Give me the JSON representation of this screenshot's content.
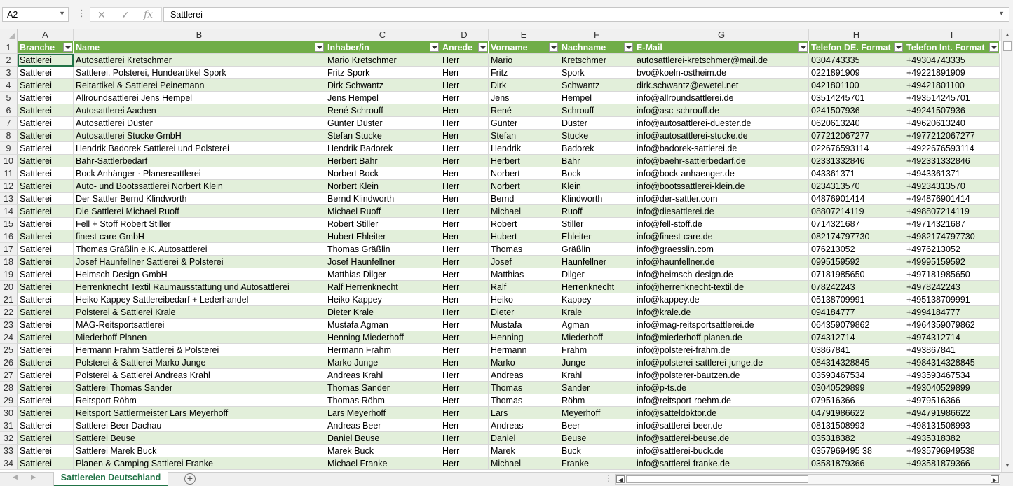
{
  "formula_bar": {
    "name_box": "A2",
    "formula": "Sattlerei",
    "cancel_glyph": "✕",
    "enter_glyph": "✓",
    "fx_glyph": "fx"
  },
  "columns": [
    "A",
    "B",
    "C",
    "D",
    "E",
    "F",
    "G",
    "H",
    "I"
  ],
  "header_row": [
    "Branche",
    "Name",
    "Inhaber/in",
    "Anrede",
    "Vorname",
    "Nachname",
    "E-Mail",
    "Telefon DE. Format",
    "Telefon Int. Format"
  ],
  "rows": [
    [
      "Sattlerei",
      "Autosattlerei Kretschmer",
      "Mario Kretschmer",
      "Herr",
      "Mario",
      "Kretschmer",
      "autosattlerei-kretschmer@mail.de",
      "0304743335",
      "+49304743335"
    ],
    [
      "Sattlerei",
      "Sattlerei, Polsterei, Hundeartikel Spork",
      "Fritz Spork",
      "Herr",
      "Fritz",
      "Spork",
      "bvo@koeln-ostheim.de",
      "0221891909",
      "+49221891909"
    ],
    [
      "Sattlerei",
      "Reitartikel & Sattlerei Peinemann",
      "Dirk Schwantz",
      "Herr",
      "Dirk",
      "Schwantz",
      "dirk.schwantz@ewetel.net",
      "0421801100",
      "+49421801100"
    ],
    [
      "Sattlerei",
      "Allroundsattlerei Jens Hempel",
      "Jens Hempel",
      "Herr",
      "Jens",
      "Hempel",
      "info@allroundsattlerei.de",
      "03514245701",
      "+493514245701"
    ],
    [
      "Sattlerei",
      "Autosattlerei Aachen",
      "René Schrouff",
      "Herr",
      "René",
      "Schrouff",
      "info@asc-schrouff.de",
      "0241507936",
      "+49241507936"
    ],
    [
      "Sattlerei",
      "Autosattlerei Düster",
      "Günter Düster",
      "Herr",
      "Günter",
      "Düster",
      "info@autosattlerei-duester.de",
      "0620613240",
      "+49620613240"
    ],
    [
      "Sattlerei",
      "Autosattlerei Stucke GmbH",
      "Stefan Stucke",
      "Herr",
      "Stefan",
      "Stucke",
      "info@autosattlerei-stucke.de",
      "077212067277",
      "+4977212067277"
    ],
    [
      "Sattlerei",
      "Hendrik Badorek Sattlerei und Polsterei",
      "Hendrik Badorek",
      "Herr",
      "Hendrik",
      "Badorek",
      "info@badorek-sattlerei.de",
      "022676593114",
      "+4922676593114"
    ],
    [
      "Sattlerei",
      "Bähr-Sattlerbedarf",
      "Herbert Bähr",
      "Herr",
      "Herbert",
      "Bähr",
      "info@baehr-sattlerbedarf.de",
      "02331332846",
      "+492331332846"
    ],
    [
      "Sattlerei",
      "Bock Anhänger · Planensattlerei",
      "Norbert Bock",
      "Herr",
      "Norbert",
      "Bock",
      "info@bock-anhaenger.de",
      "043361371",
      "+4943361371"
    ],
    [
      "Sattlerei",
      "Auto- und Bootssattlerei Norbert Klein",
      "Norbert Klein",
      "Herr",
      "Norbert",
      "Klein",
      "info@bootssattlerei-klein.de",
      "0234313570",
      "+49234313570"
    ],
    [
      "Sattlerei",
      "Der Sattler Bernd Klindworth",
      "Bernd Klindworth",
      "Herr",
      "Bernd",
      "Klindworth",
      "info@der-sattler.com",
      "04876901414",
      "+494876901414"
    ],
    [
      "Sattlerei",
      "Die Sattlerei Michael Ruoff",
      "Michael Ruoff",
      "Herr",
      "Michael",
      "Ruoff",
      "info@diesattlerei.de",
      "08807214119",
      "+498807214119"
    ],
    [
      "Sattlerei",
      "Fell + Stoff Robert Stiller",
      "Robert Stiller",
      "Herr",
      "Robert",
      "Stiller",
      "info@fell-stoff.de",
      "0714321687",
      "+49714321687"
    ],
    [
      "Sattlerei",
      "finest-care GmbH",
      "Hubert Ehleiter",
      "Herr",
      "Hubert",
      "Ehleiter",
      "info@finest-care.de",
      "082174797730",
      "+4982174797730"
    ],
    [
      "Sattlerei",
      "Thomas Gräßlin e.K. Autosattlerei",
      "Thomas Gräßlin",
      "Herr",
      "Thomas",
      "Gräßlin",
      "info@graesslin.com",
      "076213052",
      "+4976213052"
    ],
    [
      "Sattlerei",
      "Josef Haunfellner Sattlerei & Polsterei",
      "Josef Haunfellner",
      "Herr",
      "Josef",
      "Haunfellner",
      "info@haunfellner.de",
      "0995159592",
      "+49995159592"
    ],
    [
      "Sattlerei",
      "Heimsch Design GmbH",
      "Matthias Dilger",
      "Herr",
      "Matthias",
      "Dilger",
      "info@heimsch-design.de",
      "07181985650",
      "+497181985650"
    ],
    [
      "Sattlerei",
      "Herrenknecht Textil Raumausstattung und Autosattlerei",
      "Ralf Herrenknecht",
      "Herr",
      "Ralf",
      "Herrenknecht",
      "info@herrenknecht-textil.de",
      "078242243",
      "+4978242243"
    ],
    [
      "Sattlerei",
      "Heiko Kappey Sattlereibedarf + Lederhandel",
      "Heiko Kappey",
      "Herr",
      "Heiko",
      "Kappey",
      "info@kappey.de",
      "05138709991",
      "+495138709991"
    ],
    [
      "Sattlerei",
      "Polsterei & Sattlerei Krale",
      "Dieter Krale",
      "Herr",
      "Dieter",
      "Krale",
      "info@krale.de",
      "094184777",
      "+4994184777"
    ],
    [
      "Sattlerei",
      "MAG-Reitsportsattlerei",
      "Mustafa Agman",
      "Herr",
      "Mustafa",
      "Agman",
      "info@mag-reitsportsattlerei.de",
      "064359079862",
      "+4964359079862"
    ],
    [
      "Sattlerei",
      "Miederhoff Planen",
      "Henning Miederhoff",
      "Herr",
      "Henning",
      "Miederhoff",
      "info@miederhoff-planen.de",
      "074312714",
      "+4974312714"
    ],
    [
      "Sattlerei",
      "Hermann Frahm Sattlerei & Polsterei",
      "Hermann Frahm",
      "Herr",
      "Hermann",
      "Frahm",
      "info@polsterei-frahm.de",
      "03867841",
      "+493867841"
    ],
    [
      "Sattlerei",
      "Polsterei & Sattlerei Marko Junge",
      "Marko Junge",
      "Herr",
      "Marko",
      "Junge",
      "info@polsterei-sattlerei-junge.de",
      "084314328845",
      "+4984314328845"
    ],
    [
      "Sattlerei",
      "Polsterei & Sattlerei Andreas Krahl",
      "Andreas Krahl",
      "Herr",
      "Andreas",
      "Krahl",
      "info@polsterer-bautzen.de",
      "03593467534",
      "+493593467534"
    ],
    [
      "Sattlerei",
      "Sattlerei Thomas Sander",
      "Thomas Sander",
      "Herr",
      "Thomas",
      "Sander",
      "info@p-ts.de",
      "03040529899",
      "+493040529899"
    ],
    [
      "Sattlerei",
      "Reitsport Röhm",
      "Thomas Röhm",
      "Herr",
      "Thomas",
      "Röhm",
      "info@reitsport-roehm.de",
      "079516366",
      "+4979516366"
    ],
    [
      "Sattlerei",
      "Reitsport Sattlermeister Lars Meyerhoff",
      "Lars Meyerhoff",
      "Herr",
      "Lars",
      "Meyerhoff",
      "info@satteldoktor.de",
      "04791986622",
      "+494791986622"
    ],
    [
      "Sattlerei",
      "Sattlerei Beer Dachau",
      "Andreas Beer",
      "Herr",
      "Andreas",
      "Beer",
      "info@sattlerei-beer.de",
      "08131508993",
      "+498131508993"
    ],
    [
      "Sattlerei",
      "Sattlerei Beuse",
      "Daniel Beuse",
      "Herr",
      "Daniel",
      "Beuse",
      "info@sattlerei-beuse.de",
      "035318382",
      "+4935318382"
    ],
    [
      "Sattlerei",
      "Sattlerei Marek Buck",
      "Marek Buck",
      "Herr",
      "Marek",
      "Buck",
      "info@sattlerei-buck.de",
      "0357969495 38",
      "+4935796949538"
    ],
    [
      "Sattlerei",
      "Planen & Camping Sattlerei Franke",
      "Michael Franke",
      "Herr",
      "Michael",
      "Franke",
      "info@sattlerei-franke.de",
      "03581879366",
      "+493581879366"
    ]
  ],
  "sheet_tab": "Sattlereien Deutschland",
  "add_sheet_glyph": "+",
  "colors": {
    "header_green": "#70ad47",
    "band_green": "#e2efda",
    "excel_green": "#217346"
  }
}
